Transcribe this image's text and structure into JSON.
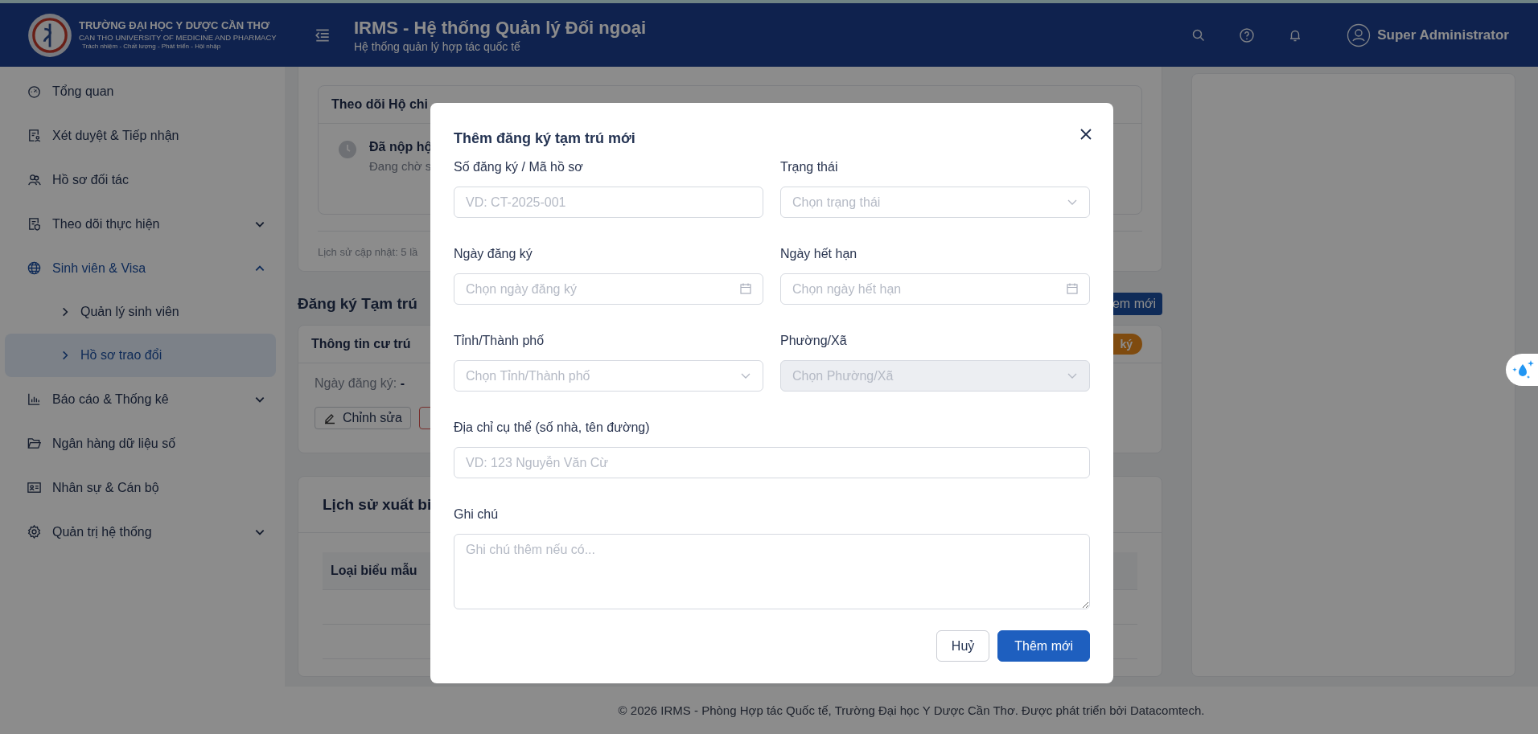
{
  "header": {
    "logo_lines": [
      "TRƯỜNG ĐẠI HỌC Y DƯỢC CẦN THƠ",
      "CAN THO UNIVERSITY OF MEDICINE AND PHARMACY",
      "Trách nhiệm - Chất lượng - Phát triển - Hội nhập"
    ],
    "title": "IRMS - Hệ thống Quản lý Đối ngoại",
    "subtitle": "Hệ thống quản lý hợp tác quốc tế",
    "user": "Super Administrator"
  },
  "sidebar": {
    "items": [
      {
        "label": "Tổng quan",
        "selected": false
      },
      {
        "label": "Xét duyệt & Tiếp nhận",
        "selected": false
      },
      {
        "label": "Hồ sơ đối tác",
        "selected": false
      },
      {
        "label": "Theo dõi thực hiện",
        "selected": false,
        "expanded": false
      },
      {
        "label": "Sinh viên & Visa",
        "selected": true,
        "expanded": true,
        "children": [
          {
            "label": "Quản lý sinh viên",
            "selected": false
          },
          {
            "label": "Hồ sơ trao đổi",
            "selected": true
          }
        ]
      },
      {
        "label": "Báo cáo & Thống kê",
        "selected": false,
        "expanded": false
      },
      {
        "label": "Ngân hàng dữ liệu số",
        "selected": false
      },
      {
        "label": "Nhân sự & Cán bộ",
        "selected": false
      },
      {
        "label": "Quản trị hệ thống",
        "selected": false,
        "expanded": false
      }
    ]
  },
  "background": {
    "passport": {
      "title": "Theo dõi Hộ chi",
      "status": "Đã nộp hộ",
      "note": "Đang chờ s",
      "history": "Lịch sử cập nhật: 5 lầ"
    },
    "residence": {
      "heading": "Đăng ký Tạm trú",
      "add_button": "em mới",
      "card_title": "Thông tin cư trú",
      "badge": "ký",
      "date_label": "Ngày đăng ký:",
      "date_value": "-",
      "edit_button": "Chỉnh sửa"
    },
    "export_history": {
      "title": "Lịch sử xuất bi",
      "column_1": "Loại biểu mẫu"
    }
  },
  "modal": {
    "title": "Thêm đăng ký tạm trú mới",
    "fields": [
      {
        "label": "Số đăng ký / Mã hồ sơ",
        "kind": "text",
        "placeholder": "VD: CT-2025-001",
        "disabled": false
      },
      {
        "label": "Trạng thái",
        "kind": "select",
        "placeholder": "Chọn trạng thái",
        "disabled": false
      },
      {
        "label": "Ngày đăng ký",
        "kind": "date",
        "placeholder": "Chọn ngày đăng ký",
        "disabled": false
      },
      {
        "label": "Ngày hết hạn",
        "kind": "date",
        "placeholder": "Chọn ngày hết hạn",
        "disabled": false
      },
      {
        "label": "Tỉnh/Thành phố",
        "kind": "select",
        "placeholder": "Chọn Tỉnh/Thành phố",
        "disabled": false
      },
      {
        "label": "Phường/Xã",
        "kind": "select",
        "placeholder": "Chọn Phường/Xã",
        "disabled": true
      },
      {
        "label": "Địa chỉ cụ thể (số nhà, tên đường)",
        "kind": "text",
        "placeholder": "VD: 123 Nguyễn Văn Cừ",
        "disabled": false
      },
      {
        "label": "Ghi chú",
        "kind": "textarea",
        "placeholder": "Ghi chú thêm nếu có...",
        "disabled": false
      }
    ],
    "buttons": [
      {
        "label": "Huỷ",
        "kind": "default"
      },
      {
        "label": "Thêm mới",
        "kind": "primary"
      }
    ]
  },
  "footer": "© 2026 IRMS - Phòng Hợp tác Quốc tế, Trường Đại học Y Dược Cần Thơ. Được phát triển bởi Datacomtech."
}
